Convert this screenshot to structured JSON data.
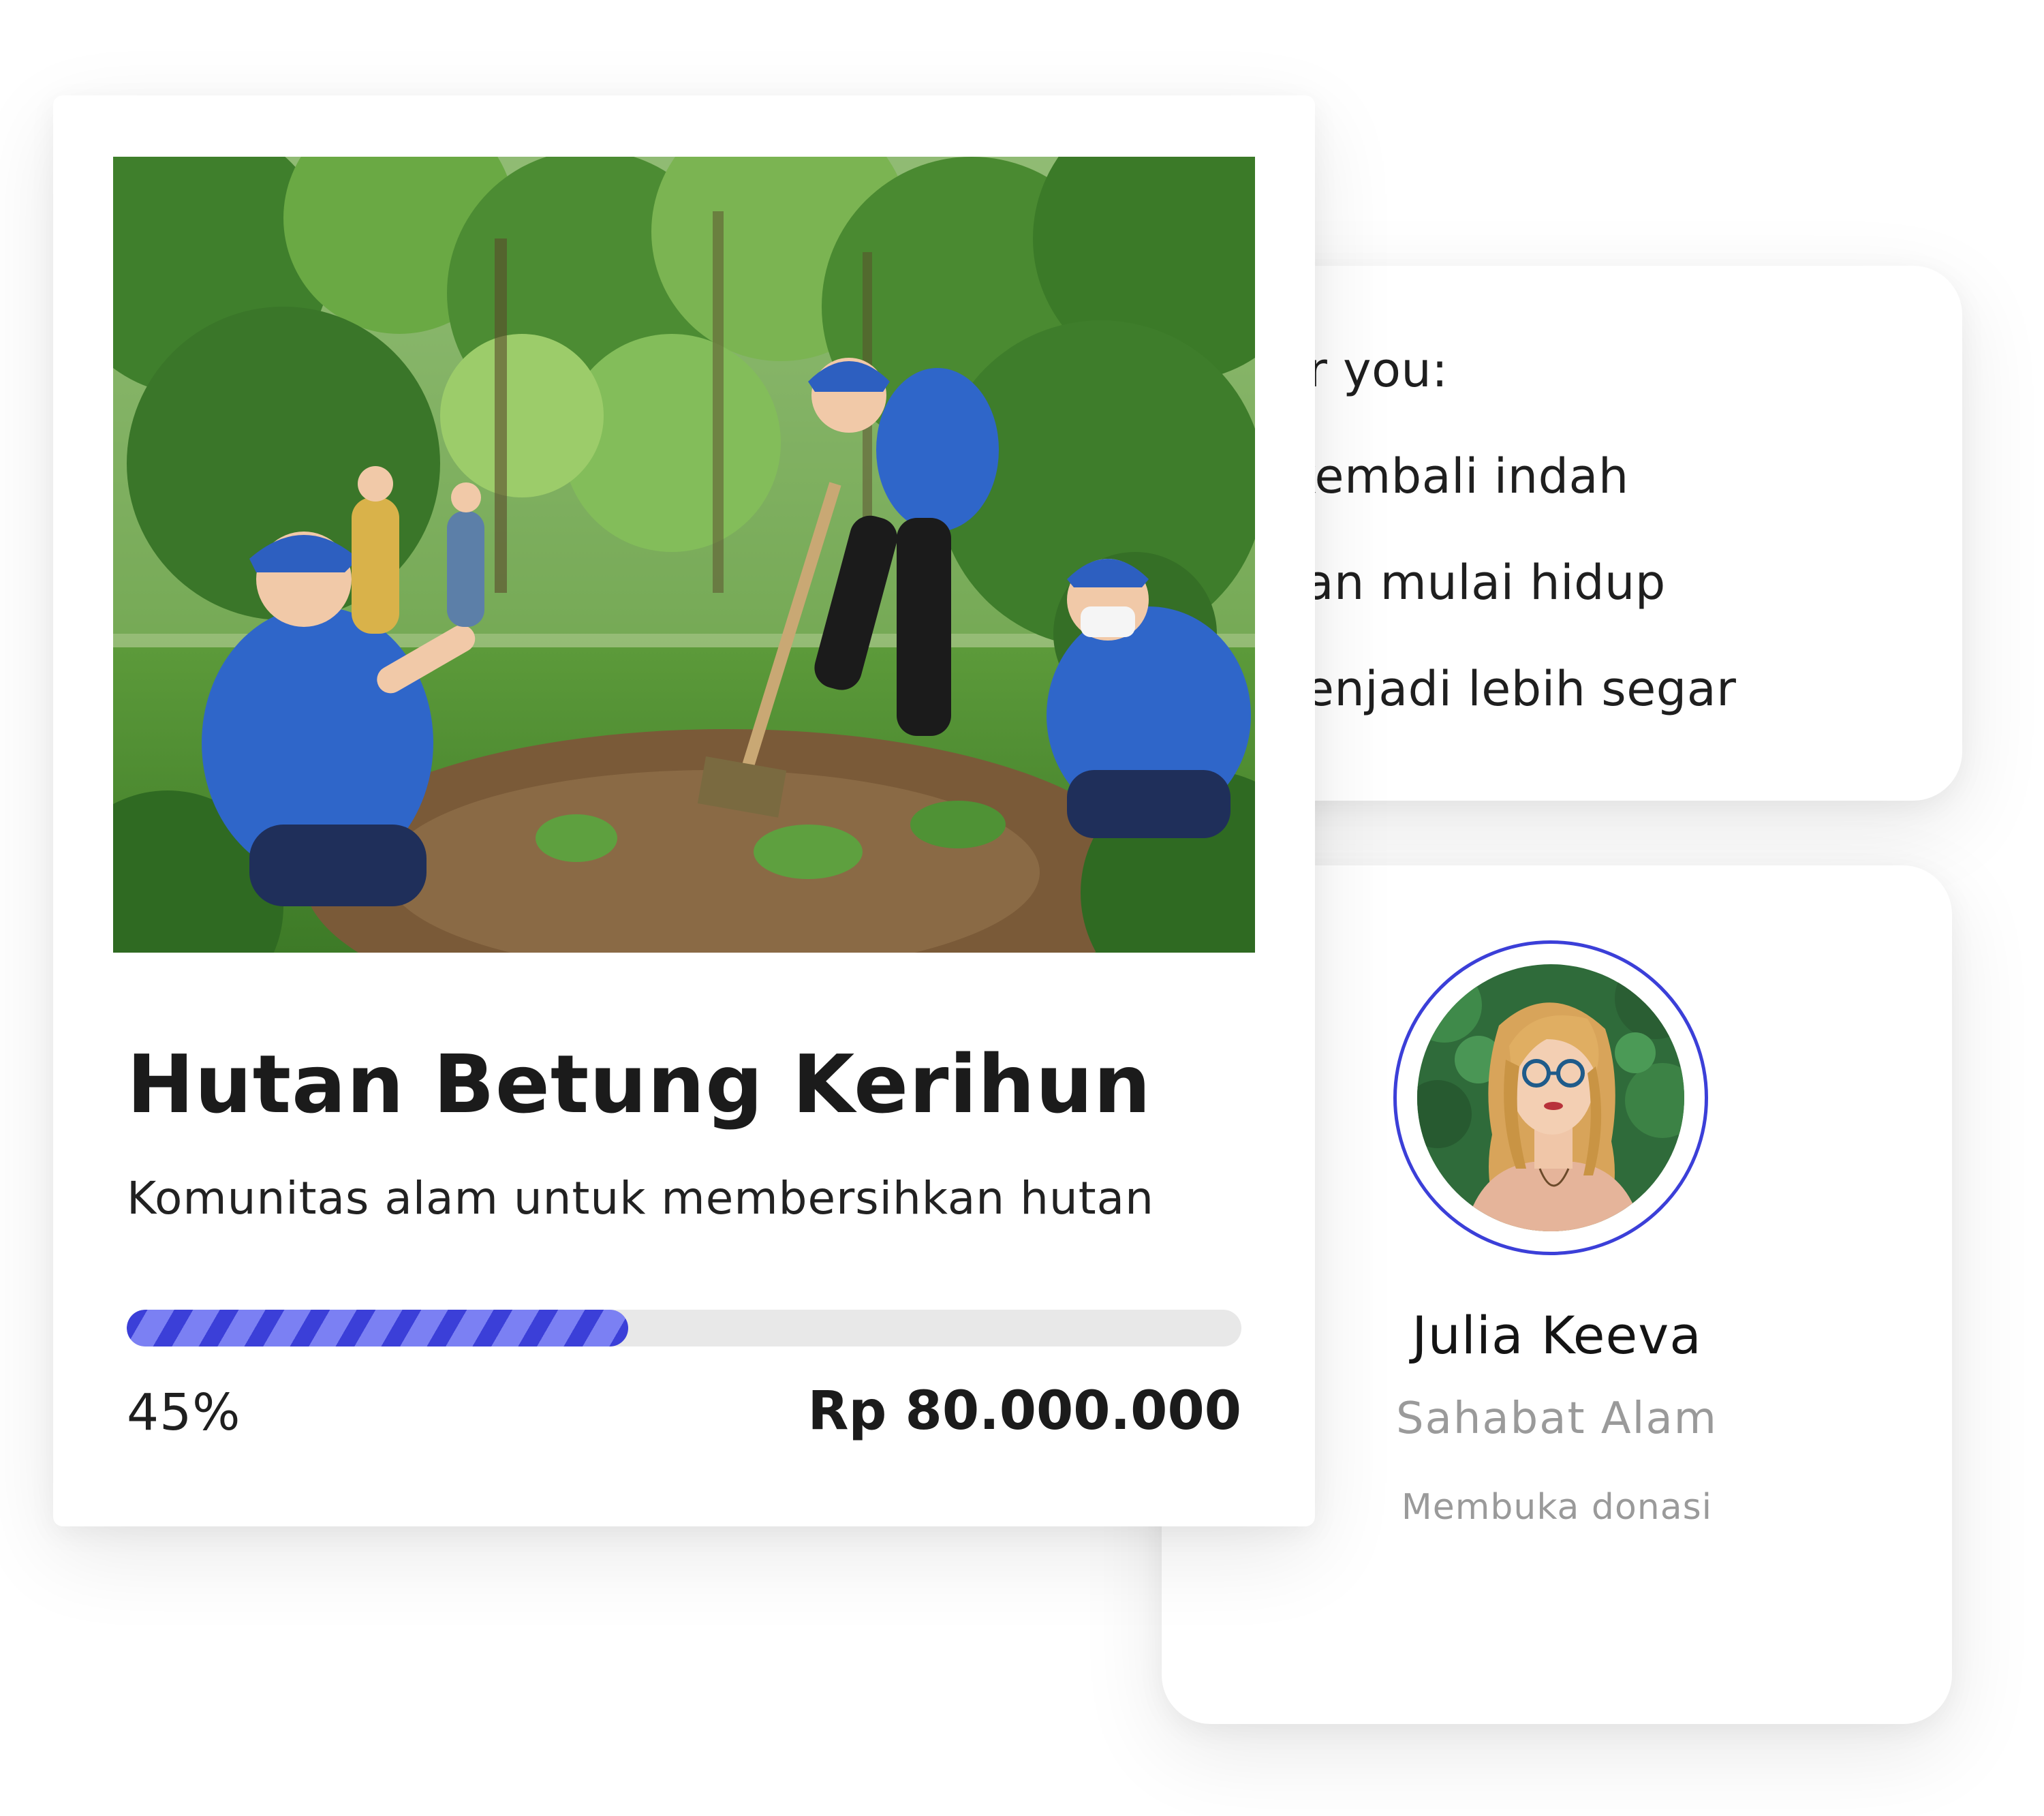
{
  "benefits": {
    "intro": "it for you:",
    "items": [
      "an kembali indah",
      "buhan mulai hidup",
      "a menjadi lebih segar"
    ]
  },
  "profile": {
    "name": "Julia Keeva",
    "role": "Sahabat Alam",
    "status": "Membuka donasi",
    "ring_color": "#3b3fd8"
  },
  "campaign": {
    "title": "Hutan Betung Kerihun",
    "subtitle": "Komunitas alam untuk membersihkan hutan",
    "progress_percent": 45,
    "progress_label": "45%",
    "target_amount": "Rp 80.000.000",
    "accent_color": "#3b3fd8",
    "accent_light": "#7b80f3"
  }
}
